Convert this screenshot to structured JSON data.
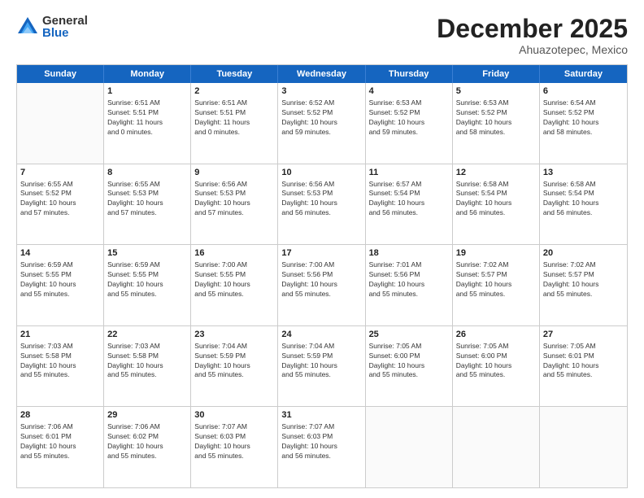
{
  "header": {
    "logo_general": "General",
    "logo_blue": "Blue",
    "month_title": "December 2025",
    "location": "Ahuazotepec, Mexico"
  },
  "calendar": {
    "days_of_week": [
      "Sunday",
      "Monday",
      "Tuesday",
      "Wednesday",
      "Thursday",
      "Friday",
      "Saturday"
    ],
    "rows": [
      [
        {
          "day": "",
          "info": ""
        },
        {
          "day": "1",
          "info": "Sunrise: 6:51 AM\nSunset: 5:51 PM\nDaylight: 11 hours\nand 0 minutes."
        },
        {
          "day": "2",
          "info": "Sunrise: 6:51 AM\nSunset: 5:51 PM\nDaylight: 11 hours\nand 0 minutes."
        },
        {
          "day": "3",
          "info": "Sunrise: 6:52 AM\nSunset: 5:52 PM\nDaylight: 10 hours\nand 59 minutes."
        },
        {
          "day": "4",
          "info": "Sunrise: 6:53 AM\nSunset: 5:52 PM\nDaylight: 10 hours\nand 59 minutes."
        },
        {
          "day": "5",
          "info": "Sunrise: 6:53 AM\nSunset: 5:52 PM\nDaylight: 10 hours\nand 58 minutes."
        },
        {
          "day": "6",
          "info": "Sunrise: 6:54 AM\nSunset: 5:52 PM\nDaylight: 10 hours\nand 58 minutes."
        }
      ],
      [
        {
          "day": "7",
          "info": "Sunrise: 6:55 AM\nSunset: 5:52 PM\nDaylight: 10 hours\nand 57 minutes."
        },
        {
          "day": "8",
          "info": "Sunrise: 6:55 AM\nSunset: 5:53 PM\nDaylight: 10 hours\nand 57 minutes."
        },
        {
          "day": "9",
          "info": "Sunrise: 6:56 AM\nSunset: 5:53 PM\nDaylight: 10 hours\nand 57 minutes."
        },
        {
          "day": "10",
          "info": "Sunrise: 6:56 AM\nSunset: 5:53 PM\nDaylight: 10 hours\nand 56 minutes."
        },
        {
          "day": "11",
          "info": "Sunrise: 6:57 AM\nSunset: 5:54 PM\nDaylight: 10 hours\nand 56 minutes."
        },
        {
          "day": "12",
          "info": "Sunrise: 6:58 AM\nSunset: 5:54 PM\nDaylight: 10 hours\nand 56 minutes."
        },
        {
          "day": "13",
          "info": "Sunrise: 6:58 AM\nSunset: 5:54 PM\nDaylight: 10 hours\nand 56 minutes."
        }
      ],
      [
        {
          "day": "14",
          "info": "Sunrise: 6:59 AM\nSunset: 5:55 PM\nDaylight: 10 hours\nand 55 minutes."
        },
        {
          "day": "15",
          "info": "Sunrise: 6:59 AM\nSunset: 5:55 PM\nDaylight: 10 hours\nand 55 minutes."
        },
        {
          "day": "16",
          "info": "Sunrise: 7:00 AM\nSunset: 5:55 PM\nDaylight: 10 hours\nand 55 minutes."
        },
        {
          "day": "17",
          "info": "Sunrise: 7:00 AM\nSunset: 5:56 PM\nDaylight: 10 hours\nand 55 minutes."
        },
        {
          "day": "18",
          "info": "Sunrise: 7:01 AM\nSunset: 5:56 PM\nDaylight: 10 hours\nand 55 minutes."
        },
        {
          "day": "19",
          "info": "Sunrise: 7:02 AM\nSunset: 5:57 PM\nDaylight: 10 hours\nand 55 minutes."
        },
        {
          "day": "20",
          "info": "Sunrise: 7:02 AM\nSunset: 5:57 PM\nDaylight: 10 hours\nand 55 minutes."
        }
      ],
      [
        {
          "day": "21",
          "info": "Sunrise: 7:03 AM\nSunset: 5:58 PM\nDaylight: 10 hours\nand 55 minutes."
        },
        {
          "day": "22",
          "info": "Sunrise: 7:03 AM\nSunset: 5:58 PM\nDaylight: 10 hours\nand 55 minutes."
        },
        {
          "day": "23",
          "info": "Sunrise: 7:04 AM\nSunset: 5:59 PM\nDaylight: 10 hours\nand 55 minutes."
        },
        {
          "day": "24",
          "info": "Sunrise: 7:04 AM\nSunset: 5:59 PM\nDaylight: 10 hours\nand 55 minutes."
        },
        {
          "day": "25",
          "info": "Sunrise: 7:05 AM\nSunset: 6:00 PM\nDaylight: 10 hours\nand 55 minutes."
        },
        {
          "day": "26",
          "info": "Sunrise: 7:05 AM\nSunset: 6:00 PM\nDaylight: 10 hours\nand 55 minutes."
        },
        {
          "day": "27",
          "info": "Sunrise: 7:05 AM\nSunset: 6:01 PM\nDaylight: 10 hours\nand 55 minutes."
        }
      ],
      [
        {
          "day": "28",
          "info": "Sunrise: 7:06 AM\nSunset: 6:01 PM\nDaylight: 10 hours\nand 55 minutes."
        },
        {
          "day": "29",
          "info": "Sunrise: 7:06 AM\nSunset: 6:02 PM\nDaylight: 10 hours\nand 55 minutes."
        },
        {
          "day": "30",
          "info": "Sunrise: 7:07 AM\nSunset: 6:03 PM\nDaylight: 10 hours\nand 55 minutes."
        },
        {
          "day": "31",
          "info": "Sunrise: 7:07 AM\nSunset: 6:03 PM\nDaylight: 10 hours\nand 56 minutes."
        },
        {
          "day": "",
          "info": ""
        },
        {
          "day": "",
          "info": ""
        },
        {
          "day": "",
          "info": ""
        }
      ]
    ]
  }
}
